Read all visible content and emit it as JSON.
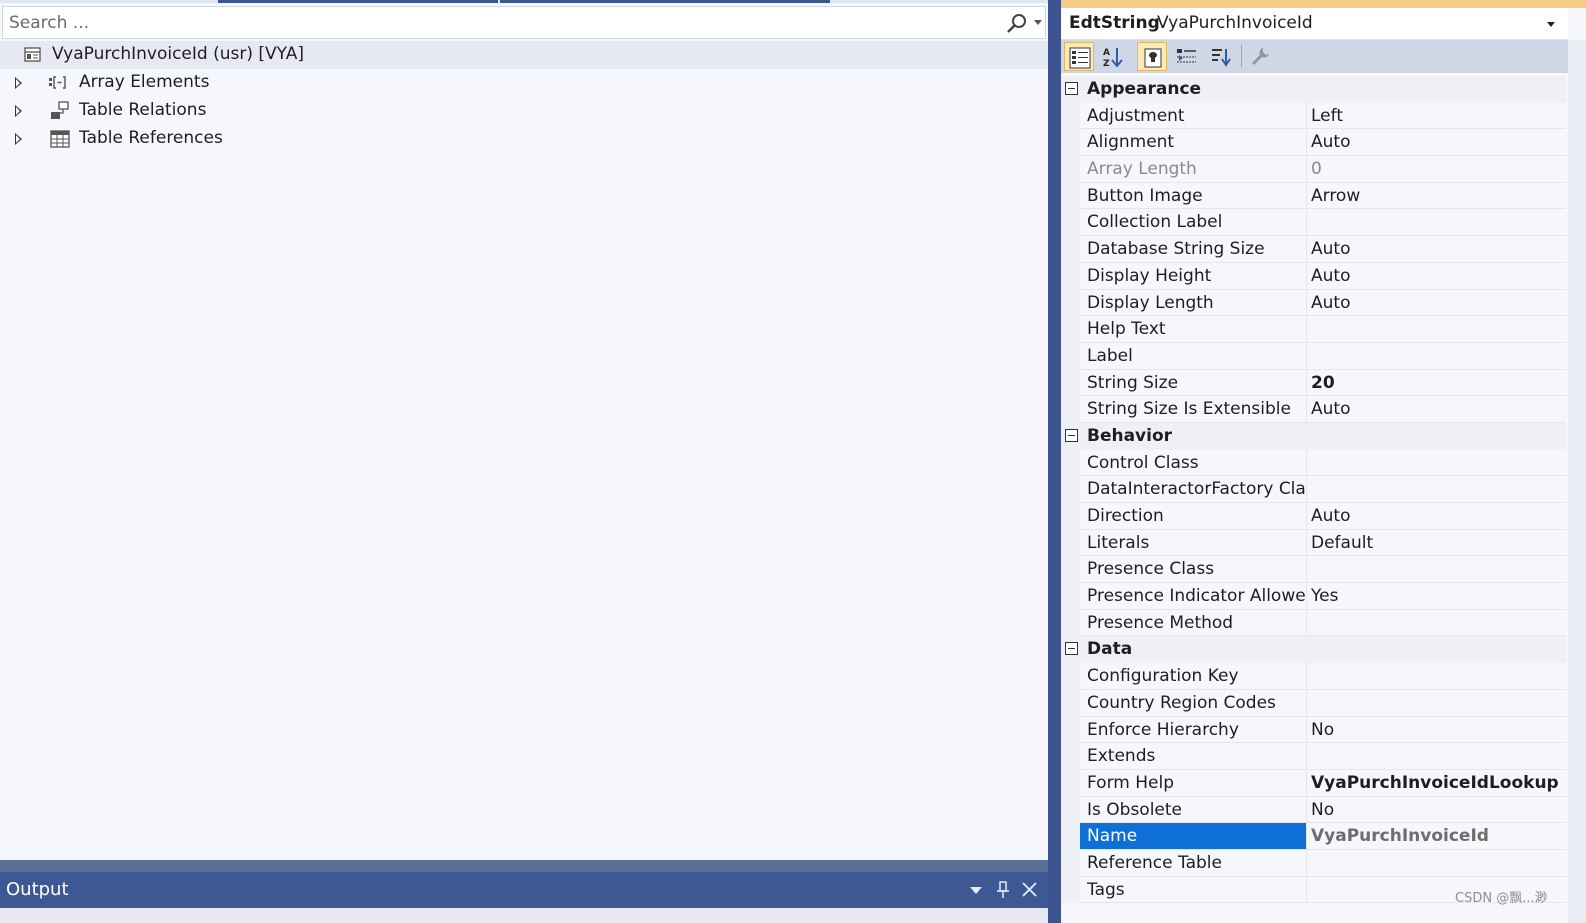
{
  "search": {
    "placeholder": "Search ..."
  },
  "tree": {
    "root_label": "VyaPurchInvoiceId (usr) [VYA]",
    "items": [
      {
        "label": "Array Elements",
        "icon": "array-elements-icon"
      },
      {
        "label": "Table Relations",
        "icon": "table-relations-icon"
      },
      {
        "label": "Table References",
        "icon": "table-grid-icon"
      }
    ]
  },
  "output": {
    "title": "Output"
  },
  "properties": {
    "object_type": "EdtString",
    "object_name": "VyaPurchInvoiceId",
    "toolbar": [
      {
        "icon": "categorized-icon",
        "active": true
      },
      {
        "icon": "alphabetical-sort-icon",
        "active": false
      },
      {
        "icon": "properties-page-icon",
        "active": true
      },
      {
        "icon": "events-icon",
        "active": false
      },
      {
        "icon": "sort-order-icon",
        "active": false
      },
      {
        "icon": "wrench-icon",
        "active": false
      }
    ],
    "categories": [
      {
        "label": "Appearance",
        "rows": [
          {
            "name": "Adjustment",
            "value": "Left"
          },
          {
            "name": "Alignment",
            "value": "Auto"
          },
          {
            "name": "Array Length",
            "value": "0",
            "disabled": true
          },
          {
            "name": "Button Image",
            "value": "Arrow"
          },
          {
            "name": "Collection Label",
            "value": ""
          },
          {
            "name": "Database String Size",
            "value": "Auto"
          },
          {
            "name": "Display Height",
            "value": "Auto"
          },
          {
            "name": "Display Length",
            "value": "Auto"
          },
          {
            "name": "Help Text",
            "value": ""
          },
          {
            "name": "Label",
            "value": ""
          },
          {
            "name": "String Size",
            "value": "20",
            "bold": true
          },
          {
            "name": "String Size Is Extensible",
            "value": "Auto"
          }
        ]
      },
      {
        "label": "Behavior",
        "rows": [
          {
            "name": "Control Class",
            "value": ""
          },
          {
            "name": "DataInteractorFactory Class",
            "value": ""
          },
          {
            "name": "Direction",
            "value": "Auto"
          },
          {
            "name": "Literals",
            "value": "Default"
          },
          {
            "name": "Presence Class",
            "value": ""
          },
          {
            "name": "Presence Indicator Allowed",
            "value": "Yes"
          },
          {
            "name": "Presence Method",
            "value": ""
          }
        ]
      },
      {
        "label": "Data",
        "rows": [
          {
            "name": "Configuration Key",
            "value": ""
          },
          {
            "name": "Country Region Codes",
            "value": ""
          },
          {
            "name": "Enforce Hierarchy",
            "value": "No"
          },
          {
            "name": "Extends",
            "value": ""
          },
          {
            "name": "Form Help",
            "value": "VyaPurchInvoiceIdLookup",
            "bold": true
          },
          {
            "name": "Is Obsolete",
            "value": "No"
          },
          {
            "name": "Name",
            "value": "VyaPurchInvoiceId",
            "selected": true
          },
          {
            "name": "Reference Table",
            "value": ""
          },
          {
            "name": "Tags",
            "value": ""
          }
        ]
      }
    ]
  },
  "watermark": "CSDN @飘...渺",
  "colors": {
    "selection": "#0e6fd6",
    "output_bar": "#3e5894",
    "splitter": "#3c5590",
    "active_tool": "#fbe9b7"
  }
}
